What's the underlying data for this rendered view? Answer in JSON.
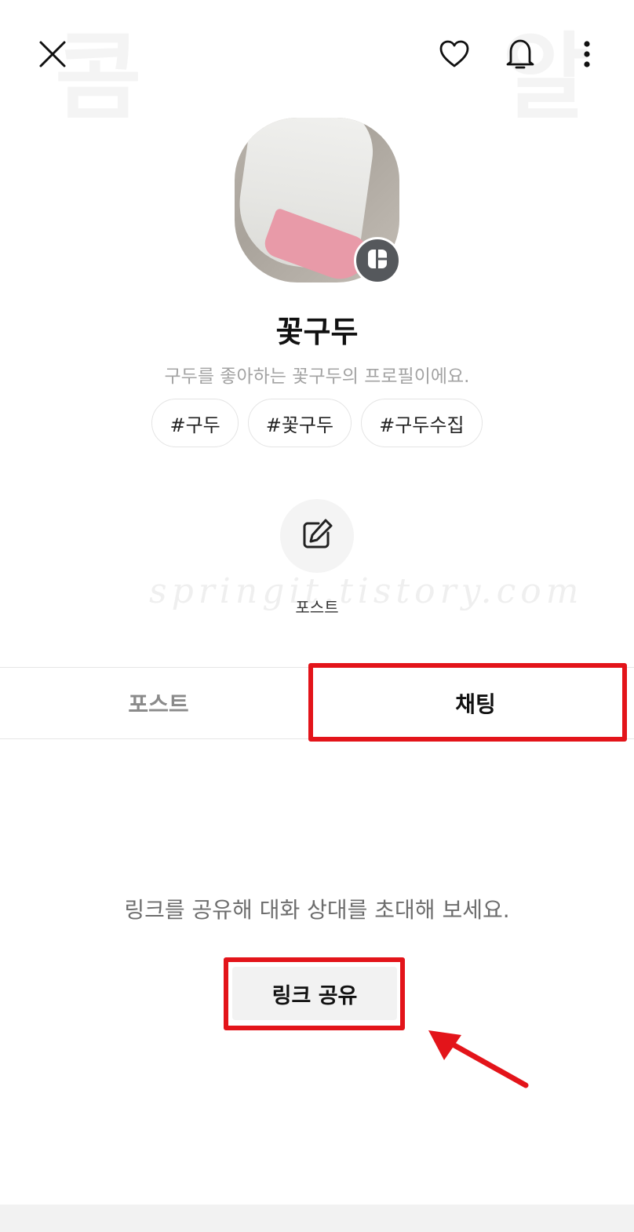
{
  "background_glyphs": {
    "left_top": "콤",
    "right_top": "알"
  },
  "topbar": {
    "close_icon": "close-icon",
    "heart_icon": "heart-icon",
    "bell_icon": "bell-icon",
    "more_icon": "more-vertical-icon"
  },
  "profile": {
    "name": "꽃구두",
    "bio": "구두를 좋아하는 꽃구두의 프로필이에요.",
    "tags": [
      "#구두",
      "#꽃구두",
      "#구두수집"
    ]
  },
  "post_action": {
    "label": "포스트"
  },
  "watermark": "springit.tistory.com",
  "tabs": [
    {
      "label": "포스트",
      "active": false
    },
    {
      "label": "채팅",
      "active": true
    }
  ],
  "chat": {
    "invite_text": "링크를 공유해 대화 상대를 초대해 보세요.",
    "share_button": "링크 공유"
  },
  "colors": {
    "highlight": "#e3141a",
    "badge": "#55585c"
  }
}
